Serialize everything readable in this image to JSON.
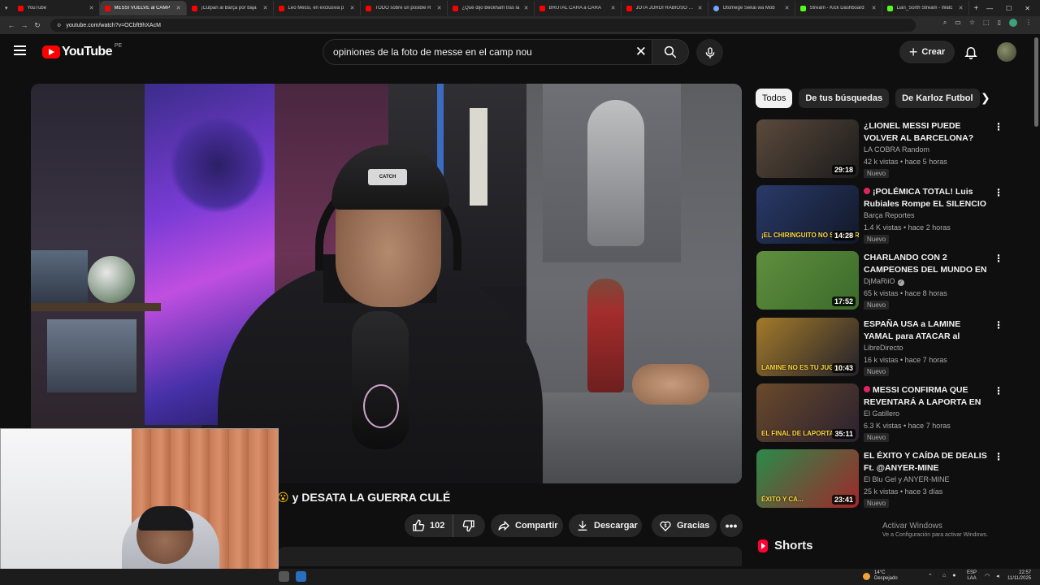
{
  "browser": {
    "tabs": [
      {
        "label": "YouTube",
        "favicon": "youtube-icon",
        "active": false
      },
      {
        "label": "MESSI VUELVE al CAMP",
        "favicon": "youtube-icon",
        "active": true
      },
      {
        "label": "¡Culpan al Barça por baja",
        "favicon": "youtube-icon",
        "active": false
      },
      {
        "label": "Leo Messi, en exclusiva p",
        "favicon": "youtube-icon",
        "active": false
      },
      {
        "label": "TODO sobre un posible R",
        "favicon": "youtube-icon",
        "active": false
      },
      {
        "label": "¿Qué dijo Beckham tras la",
        "favicon": "youtube-icon",
        "active": false
      },
      {
        "label": "BRUTAL CARA a CARA",
        "favicon": "youtube-icon",
        "active": false
      },
      {
        "label": "JOTA JORDI RABIOSO con",
        "favicon": "youtube-icon",
        "active": false
      },
      {
        "label": "Otomege Sekai wa Mob",
        "favicon": "globe-icon",
        "active": false
      },
      {
        "label": "Stream - Kick Dashboard",
        "favicon": "kick-icon",
        "active": false
      },
      {
        "label": "Lian_Sorth Stream - Watc",
        "favicon": "kick-icon",
        "active": false
      }
    ],
    "url": "youtube.com/watch?v=OCbft9hXAcM"
  },
  "header": {
    "logo_text": "YouTube",
    "country_code": "PE",
    "search_value": "opiniones de la foto de messe en el camp nou",
    "create_label": "Crear"
  },
  "video": {
    "title_emoji": "😮",
    "title": "y DESATA LA GUERRA CULÉ",
    "beanie_text": "CATCH",
    "like_count": "102",
    "share_label": "Compartir",
    "download_label": "Descargar",
    "thanks_label": "Gracias"
  },
  "sidebar": {
    "chips": [
      "Todos",
      "De tus búsquedas",
      "De Karloz Futbol"
    ],
    "recommendations": [
      {
        "title": "¿LIONEL MESSI PUEDE VOLVER AL BARCELONA? FUE AL CAM...",
        "channel": "LA COBRA Random",
        "meta": "42 k vistas • hace 5 horas",
        "badge": "Nuevo",
        "duration": "29:18",
        "overlay": "",
        "colors": [
          "#5b4a3c",
          "#1b1b1b"
        ],
        "dot": false,
        "verified": false
      },
      {
        "title": "¡POLÉMICA TOTAL! Luis Rubiales Rompe EL SILENCIO ...",
        "channel": "Barça Reportes",
        "meta": "1.4 K vistas • hace 2 horas",
        "badge": "Nuevo",
        "duration": "14:28",
        "overlay": "¡EL CHIRINGUITO NO SE GUAR...",
        "colors": [
          "#2a3a6a",
          "#111827"
        ],
        "dot": true,
        "verified": false
      },
      {
        "title": "CHARLANDO CON 2 CAMPEONES DEL MUNDO EN ...",
        "channel": "DjMaRiiO",
        "meta": "65 k vistas • hace 8 horas",
        "badge": "Nuevo",
        "duration": "17:52",
        "overlay": "",
        "colors": [
          "#5f8f3e",
          "#3b6a2a"
        ],
        "dot": false,
        "verified": true
      },
      {
        "title": "ESPAÑA USA a LAMINE YAMAL para ATACAR al BARÇA y el ...",
        "channel": "LibreDirecto",
        "meta": "16 k vistas • hace 7 horas",
        "badge": "Nuevo",
        "duration": "10:43",
        "overlay": "LAMINE NO ES TU JUGUETE",
        "colors": [
          "#a37a2a",
          "#23212a"
        ],
        "dot": false,
        "verified": false
      },
      {
        "title": "MESSI CONFIRMA QUE REVENTARÁ A LAPORTA EN ...",
        "channel": "El Gatillero",
        "meta": "6.3 K vistas • hace 7 horas",
        "badge": "Nuevo",
        "duration": "35:11",
        "overlay": "EL FINAL DE LAPORTA",
        "colors": [
          "#6a4a2a",
          "#2a2030"
        ],
        "dot": true,
        "verified": false
      },
      {
        "title": "EL ÉXITO Y CAÍDA DE DEALIS Ft. @ANYER-MINE",
        "channel": "El Blu Gel y ANYER-MINE",
        "meta": "25 k vistas • hace 3 días",
        "badge": "Nuevo",
        "duration": "23:41",
        "overlay": "ÉXITO Y CA...",
        "colors": [
          "#2a8a4a",
          "#a0282a"
        ],
        "dot": false,
        "verified": false
      }
    ],
    "shorts_label": "Shorts"
  },
  "watermark": {
    "line1": "Activar Windows",
    "line2": "Ve a Configuración para activar Windows."
  },
  "taskbar": {
    "temperature": "14°C",
    "weather": "Despejado",
    "lang1": "ESP",
    "lang2": "LAA",
    "time": "22:57",
    "date": "11/11/2025"
  }
}
